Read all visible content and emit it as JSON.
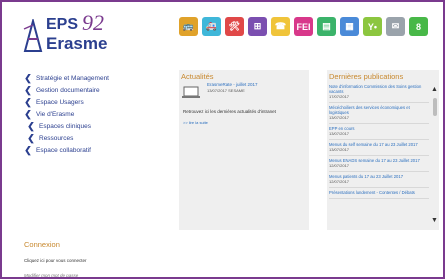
{
  "logo": {
    "name_top": "EPS",
    "name_number": "92",
    "name_bottom": "Erasme"
  },
  "toolbar": [
    {
      "icon": "bus-icon",
      "color": "#e0a22a",
      "glyph": "🚌"
    },
    {
      "icon": "ambulance-icon",
      "color": "#3fb7d9",
      "glyph": "🚑"
    },
    {
      "icon": "tools-icon",
      "color": "#e04848",
      "glyph": "🛠"
    },
    {
      "icon": "org-chart-icon",
      "color": "#7b4fb0",
      "glyph": "⊞"
    },
    {
      "icon": "phone-icon",
      "color": "#f0c43a",
      "glyph": "☎"
    },
    {
      "icon": "fei-icon",
      "color": "#d8388a",
      "glyph": "FEI"
    },
    {
      "icon": "document-icon",
      "color": "#3bb36a",
      "glyph": "▤"
    },
    {
      "icon": "calendar-icon",
      "color": "#4a8ad8",
      "glyph": "▦"
    },
    {
      "icon": "yoga-icon",
      "color": "#8cc63f",
      "glyph": "Y•"
    },
    {
      "icon": "mail-icon",
      "color": "#9aa3ab",
      "glyph": "✉"
    },
    {
      "icon": "eight-icon",
      "color": "#48b848",
      "glyph": "8"
    }
  ],
  "nav": [
    {
      "label": "Stratégie et Management",
      "indent": false
    },
    {
      "label": "Gestion documentaire",
      "indent": false
    },
    {
      "label": "Espace Usagers",
      "indent": false
    },
    {
      "label": "Vie d'Erasme",
      "indent": false
    },
    {
      "label": "Espaces cliniques",
      "indent": true
    },
    {
      "label": "Ressources",
      "indent": true
    },
    {
      "label": "Espace collaboratif",
      "indent": false
    }
  ],
  "news": {
    "title": "Actualités",
    "entry_link": "ErasmeRate - juillet 2017",
    "entry_date": "13/07/2017 SESAME",
    "text": "Retrouvez ici les dernières actualités d'intranet",
    "more": ">> lire la suite"
  },
  "publications": {
    "title": "Dernières publications",
    "items": [
      {
        "name": "Note d'information Commission des Soins gestion vacants",
        "date": "17/07/2017"
      },
      {
        "name": "Mécéchoiliers des services économiques et logistiques",
        "date": "13/07/2017"
      },
      {
        "name": "EPP en cours",
        "date": "13/07/2017"
      },
      {
        "name": "Menus du self semaine du 17 au 23 Juillet 2017",
        "date": "13/07/2017"
      },
      {
        "name": "Menus ENADS semaine du 17 au 23 Juillet 2017",
        "date": "12/07/2017"
      },
      {
        "name": "Menus patients du 17 au 23 Juillet 2017",
        "date": "12/07/2017"
      },
      {
        "name": "Présentations lundement - Contentes / Débats",
        "date": ""
      }
    ]
  },
  "login": {
    "title": "Connexion",
    "link": "Cliquez ici pour vous connecter",
    "password": "Modifier mon mot de passe"
  }
}
